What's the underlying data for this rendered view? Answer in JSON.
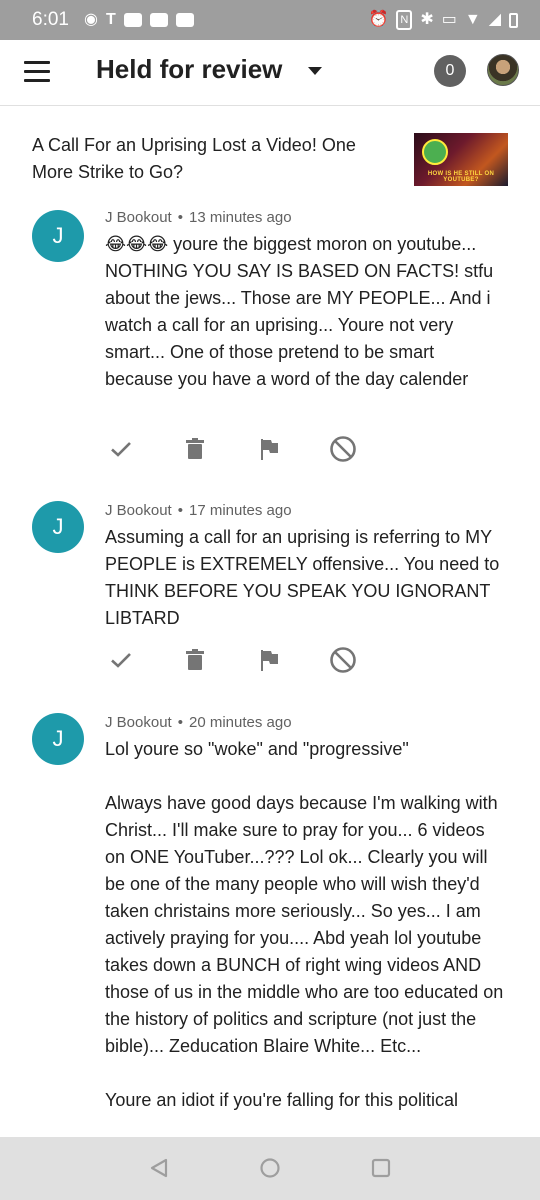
{
  "status_bar": {
    "time": "6:01",
    "icons": [
      "location-icon",
      "t-icon",
      "youtube-icon",
      "youtube-icon",
      "youtube-icon",
      "alarm-icon",
      "nfc-icon",
      "bluetooth-icon",
      "vibrate-icon",
      "wifi-icon",
      "signal-icon",
      "battery-icon"
    ]
  },
  "app_bar": {
    "title": "Held for review",
    "count": "0"
  },
  "video": {
    "title": "A Call For an Uprising Lost a Video! One More Strike to Go?",
    "thumbnail_text": "HOW IS HE STILL ON YOUTUBE?"
  },
  "comments": [
    {
      "initial": "J",
      "author": "J Bookout",
      "time": "13 minutes ago",
      "text": "😂😂😂 youre the biggest moron on youtube... NOTHING YOU SAY IS BASED ON FACTS! stfu about the jews... Those are MY PEOPLE... And i watch a call for an uprising... Youre not very smart... One of those pretend to be smart because you have a word of the day calender"
    },
    {
      "initial": "J",
      "author": "J Bookout",
      "time": "17 minutes ago",
      "text": "Assuming a call for an uprising is referring to MY PEOPLE is EXTREMELY offensive... You need to THINK BEFORE YOU SPEAK YOU IGNORANT LIBTARD"
    },
    {
      "initial": "J",
      "author": "J Bookout",
      "time": "20 minutes ago",
      "text": "Lol youre so \"woke\" and \"progressive\"\n\nAlways have good days because I'm walking with Christ... I'll make sure to pray for you... 6 videos on ONE YouTuber...??? Lol ok... Clearly you will be one of the many people who will wish they'd taken christains more seriously... So yes... I am actively praying for you.... Abd yeah lol youtube takes down a BUNCH of right wing videos AND those of us in the middle who are too educated on the history of politics and scripture (not just the bible)... Zeducation Blaire White... Etc...\n\nYoure an idiot if you're falling for this political"
    }
  ],
  "colors": {
    "avatar": "#1e9aaa",
    "status_bar": "#9e9e9e",
    "nav_bar": "#e0e0e0",
    "action_icons": "#757575"
  }
}
